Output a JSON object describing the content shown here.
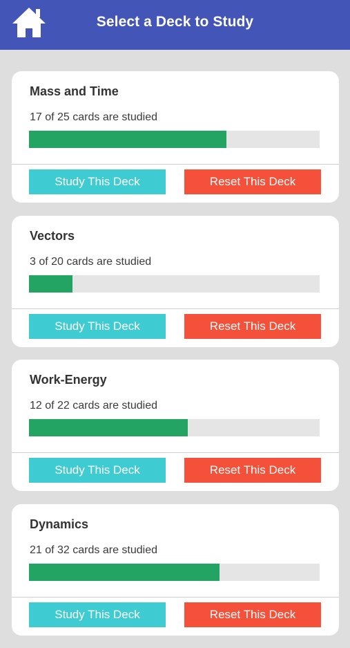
{
  "header": {
    "title": "Select a Deck to Study",
    "home_icon": "home-icon"
  },
  "colors": {
    "header": "#4355b6",
    "progress_fill": "#23a463",
    "study_button": "#3ecbd1",
    "reset_button": "#f5513a"
  },
  "decks": [
    {
      "title": "Mass and Time",
      "progress_text": "17 of 25 cards are studied",
      "studied": 17,
      "total": 25,
      "study_label": "Study This Deck",
      "reset_label": "Reset This Deck"
    },
    {
      "title": "Vectors",
      "progress_text": "3 of 20 cards are studied",
      "studied": 3,
      "total": 20,
      "study_label": "Study This Deck",
      "reset_label": "Reset This Deck"
    },
    {
      "title": "Work-Energy",
      "progress_text": "12 of 22 cards are studied",
      "studied": 12,
      "total": 22,
      "study_label": "Study This Deck",
      "reset_label": "Reset This Deck"
    },
    {
      "title": "Dynamics",
      "progress_text": "21 of 32 cards are studied",
      "studied": 21,
      "total": 32,
      "study_label": "Study This Deck",
      "reset_label": "Reset This Deck"
    }
  ]
}
